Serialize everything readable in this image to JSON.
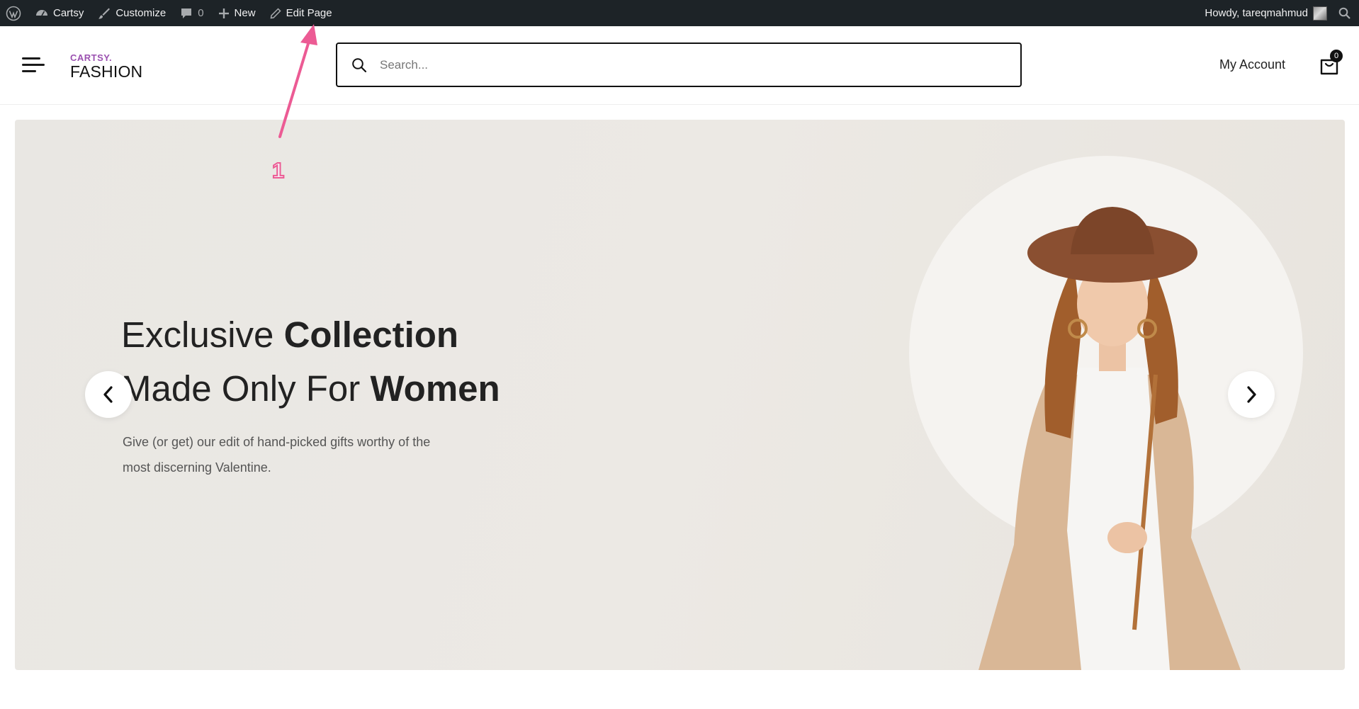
{
  "admin_bar": {
    "site_name": "Cartsy",
    "customize": "Customize",
    "comments_count": "0",
    "new": "New",
    "edit_page": "Edit Page",
    "howdy": "Howdy, tareqmahmud"
  },
  "header": {
    "logo_top": "CARTSY.",
    "logo_main": "FASHION",
    "search_placeholder": "Search...",
    "my_account": "My Account",
    "cart_count": "0"
  },
  "hero": {
    "line1_regular": "Exclusive ",
    "line1_bold": "Collection",
    "line2_regular": "Made Only For ",
    "line2_bold": "Women",
    "description_line1": "Give (or get) our edit of hand-picked gifts worthy of the",
    "description_line2": "most discerning Valentine."
  },
  "annotation": {
    "number": "1"
  },
  "colors": {
    "admin_bar_bg": "#1d2327",
    "logo_accent": "#9b51b0",
    "annotation_arrow": "#ec5b94",
    "hero_bg": "#ebe8e3"
  }
}
